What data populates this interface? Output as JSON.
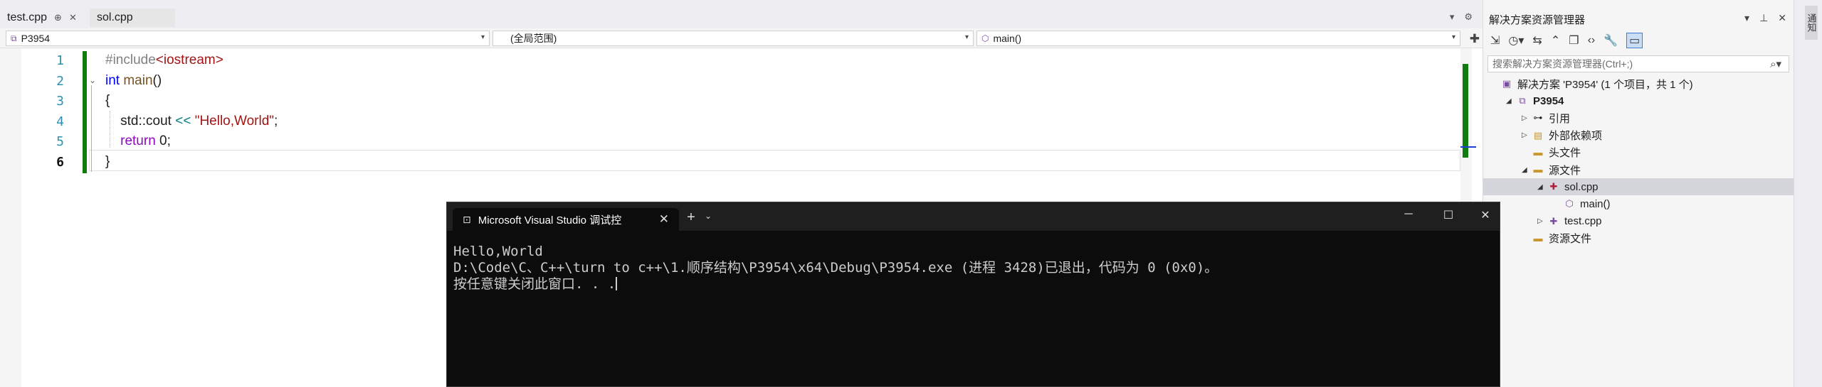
{
  "editor": {
    "tabs": [
      {
        "label": "test.cpp",
        "active": true
      },
      {
        "label": "sol.cpp",
        "active": false
      }
    ],
    "nav": {
      "project": "P3954",
      "scope": "(全局范围)",
      "member": "main()"
    },
    "lines": [
      {
        "num": "1",
        "tokens": [
          {
            "t": "#include",
            "c": "pre"
          },
          {
            "t": "<iostream>",
            "c": "inc"
          }
        ]
      },
      {
        "num": "2",
        "tokens": [
          {
            "t": "int",
            "c": "kw"
          },
          {
            "t": " "
          },
          {
            "t": "main",
            "c": "fn"
          },
          {
            "t": "()"
          }
        ]
      },
      {
        "num": "3",
        "tokens": [
          {
            "t": "{"
          }
        ]
      },
      {
        "num": "4",
        "tokens": [
          {
            "t": "    std::cout "
          },
          {
            "t": "<<",
            "c": "op"
          },
          {
            "t": " "
          },
          {
            "t": "\"Hello,World\"",
            "c": "str"
          },
          {
            "t": ";"
          }
        ]
      },
      {
        "num": "5",
        "tokens": [
          {
            "t": "    "
          },
          {
            "t": "return",
            "c": "kw2"
          },
          {
            "t": " 0;"
          }
        ]
      },
      {
        "num": "6",
        "tokens": [
          {
            "t": "}"
          }
        ]
      }
    ],
    "current_line": "6"
  },
  "solution_explorer": {
    "title": "解决方案资源管理器",
    "search_placeholder": "搜索解决方案资源管理器(Ctrl+;)",
    "tree": [
      {
        "label": "解决方案 'P3954' (1 个项目，共 1 个)",
        "indent": 0,
        "twisty": "",
        "icon": "solution-icon",
        "glyph": "▣",
        "cls": "proj"
      },
      {
        "label": "P3954",
        "indent": 1,
        "twisty": "◢",
        "icon": "project-icon",
        "glyph": "⧉",
        "cls": "proj",
        "bold": true
      },
      {
        "label": "引用",
        "indent": 2,
        "twisty": "▷",
        "icon": "references-icon",
        "glyph": "⊶",
        "cls": ""
      },
      {
        "label": "外部依赖项",
        "indent": 2,
        "twisty": "▷",
        "icon": "external-deps-icon",
        "glyph": "▤",
        "cls": "folder"
      },
      {
        "label": "头文件",
        "indent": 2,
        "twisty": "",
        "icon": "folder-icon",
        "glyph": "▬",
        "cls": "folder"
      },
      {
        "label": "源文件",
        "indent": 2,
        "twisty": "◢",
        "icon": "folder-icon",
        "glyph": "▬",
        "cls": "folder"
      },
      {
        "label": "sol.cpp",
        "indent": 3,
        "twisty": "◢",
        "icon": "cpp-file-icon",
        "glyph": "✚",
        "cls": "cpp",
        "selected": true
      },
      {
        "label": "main()",
        "indent": 4,
        "twisty": "",
        "icon": "function-icon",
        "glyph": "⬡",
        "cls": "fnic"
      },
      {
        "label": "test.cpp",
        "indent": 3,
        "twisty": "▷",
        "icon": "cpp-file-icon",
        "glyph": "✚",
        "cls": "proj"
      },
      {
        "label": "资源文件",
        "indent": 2,
        "twisty": "",
        "icon": "folder-icon",
        "glyph": "▬",
        "cls": "folder"
      }
    ]
  },
  "right_strip": {
    "notification_label": "通知"
  },
  "console": {
    "tab_title": "Microsoft Visual Studio 调试控",
    "output_lines": [
      "Hello,World",
      "D:\\Code\\C、C++\\turn to c++\\1.顺序结构\\P3954\\x64\\Debug\\P3954.exe (进程 3428)已退出，代码为 0 (0x0)。",
      "按任意键关闭此窗口. . ."
    ]
  }
}
